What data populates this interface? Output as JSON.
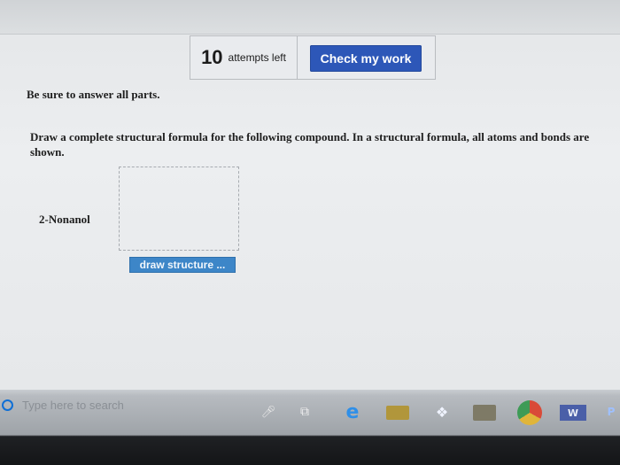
{
  "toolbar": {
    "attempts_count": "10",
    "attempts_label": "attempts left",
    "check_label": "Check my work"
  },
  "instructions": {
    "note": "Be sure to answer all parts.",
    "question": "Draw a complete structural formula for the following compound. In a structural formula, all atoms and bonds are shown."
  },
  "problem": {
    "compound": "2-Nonanol",
    "draw_button_label": "draw structure ..."
  },
  "taskbar": {
    "search_placeholder": "Type here to search",
    "word_label": "W",
    "pp_label": "P"
  },
  "colors": {
    "check_button": "#2d57b8",
    "draw_button": "#3d86c8"
  }
}
